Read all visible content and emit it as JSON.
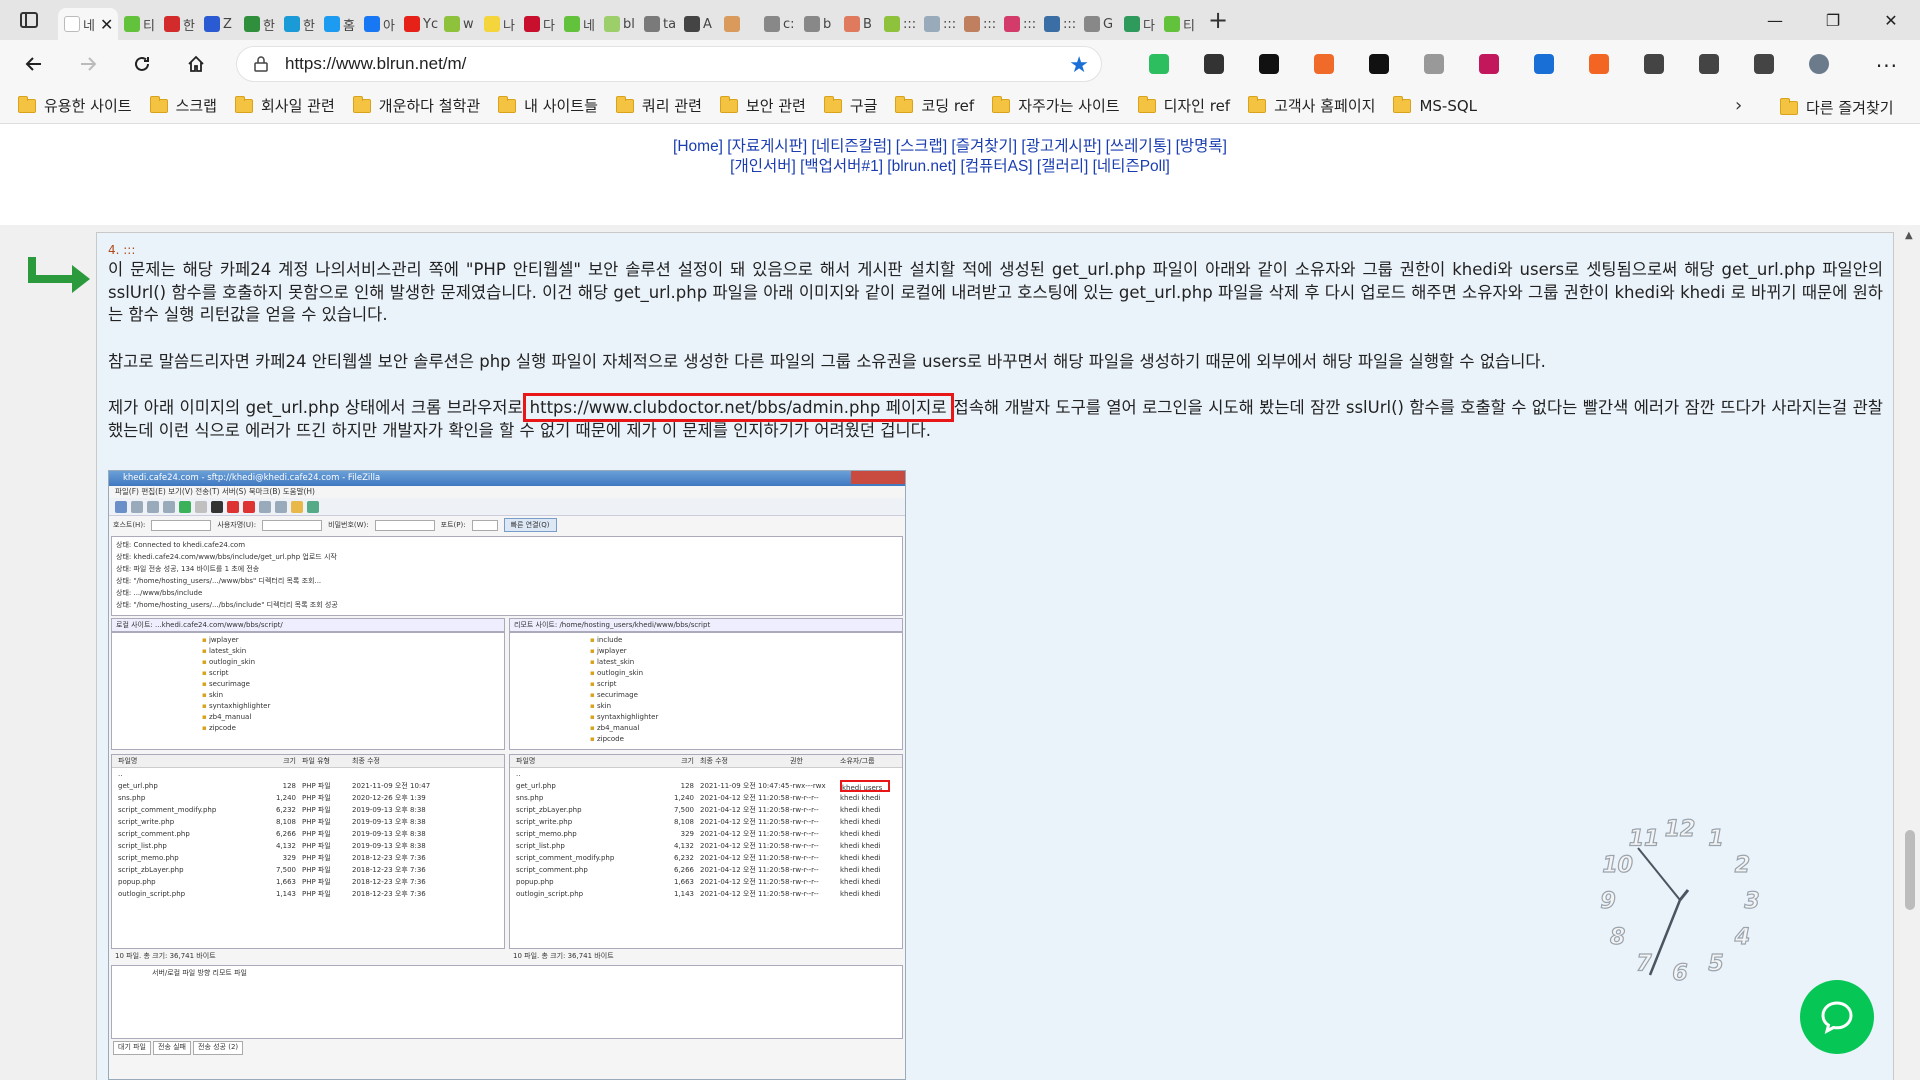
{
  "browser": {
    "tabs": [
      {
        "label": "네",
        "color": "#ffffff",
        "active": true
      },
      {
        "label": "티",
        "color": "#63c23c"
      },
      {
        "label": "한",
        "color": "#d32b2b"
      },
      {
        "label": "Z",
        "color": "#2b5bd3"
      },
      {
        "label": "한",
        "color": "#2f8f3c"
      },
      {
        "label": "한",
        "color": "#1a9ad6"
      },
      {
        "label": "홈",
        "color": "#1d9bf0"
      },
      {
        "label": "아",
        "color": "#1877f2"
      },
      {
        "label": "Yc",
        "color": "#e62117"
      },
      {
        "label": "w",
        "color": "#8fc23c"
      },
      {
        "label": "나",
        "color": "#f5d53c"
      },
      {
        "label": "다",
        "color": "#c8102e"
      },
      {
        "label": "네",
        "color": "#63c23c"
      },
      {
        "label": "bl",
        "color": "#9ccf6a"
      },
      {
        "label": "ta",
        "color": "#7a7a7a"
      },
      {
        "label": "A",
        "color": "#444444"
      },
      {
        "label": "",
        "color": "#d99a5c"
      },
      {
        "label": "c:",
        "color": "#888888"
      },
      {
        "label": "b",
        "color": "#888888"
      },
      {
        "label": "B",
        "color": "#e07a5f"
      },
      {
        "label": ":::",
        "color": "#8fc23c"
      },
      {
        "label": ":::",
        "color": "#9ab"
      },
      {
        "label": ":::",
        "color": "#c08060"
      },
      {
        "label": ":::",
        "color": "#d33b6a"
      },
      {
        "label": ":::",
        "color": "#3a6ea5"
      },
      {
        "label": "G",
        "color": "#888888"
      },
      {
        "label": "다",
        "color": "#2e9a5c"
      },
      {
        "label": "티",
        "color": "#63c23c"
      }
    ],
    "new_tab_label": "+",
    "window": {
      "minimize": "—",
      "restore": "❐",
      "close": "✕"
    },
    "url": "https://www.blrun.net/m/",
    "extensions": [
      {
        "name": "evernote-icon",
        "color": "#2dbe60"
      },
      {
        "name": "e-circle-icon",
        "color": "#333333"
      },
      {
        "name": "binary-icon",
        "color": "#111111"
      },
      {
        "name": "ex-icon",
        "color": "#f06a2a"
      },
      {
        "name": "download-arrow-icon",
        "color": "#111111"
      },
      {
        "name": "camera-icon",
        "color": "#999999"
      },
      {
        "name": "color-wheel-icon",
        "color": "#c2185b"
      },
      {
        "name": "layers-icon",
        "color": "#1a6fd6"
      },
      {
        "name": "rss-icon",
        "color": "#f26522"
      },
      {
        "name": "puzzle-icon",
        "color": "#444444"
      },
      {
        "name": "favorites-icon",
        "color": "#444444"
      },
      {
        "name": "collections-icon",
        "color": "#444444"
      },
      {
        "name": "profile-avatar-icon",
        "color": "#6b7b8c"
      }
    ]
  },
  "bookmarks": {
    "items": [
      "유용한 사이트",
      "스크랩",
      "회사일 관련",
      "개운하다 철학관",
      "내 사이트들",
      "쿼리 관련",
      "보안 관련",
      "구글",
      "코딩 ref",
      "자주가는 사이트",
      "디자인 ref",
      "고객사 홈페이지",
      "MS-SQL"
    ],
    "more": "›",
    "other": "다른 즐겨찾기"
  },
  "topnav": {
    "line1": "[Home] [자료게시판] [네티즌칼럼] [스크랩] [즐겨찾기] [광고게시판] [쓰레기통] [방명록]",
    "line2": "[개인서버] [백업서버#1] [blrun.net] [컴퓨터AS] [갤러리] [네티즌Poll]"
  },
  "post": {
    "number": "4. :::",
    "para1": "이 문제는 해당 카페24 계정 나의서비스관리 쪽에 \"PHP 안티웹셀\" 보안 솔루션 설정이 돼 있음으로 해서 게시판 설치할 적에 생성된 get_url.php 파일이 아래와 같이 소유자와 그룹 권한이 khedi와 users로 셋팅됨으로써 해당 get_url.php 파일안의 sslUrl() 함수를 호출하지 못함으로 인해 발생한 문제였습니다. 이건 해당 get_url.php 파일을 아래 이미지와 같이 로컬에 내려받고 호스팅에 있는 get_url.php 파일을 삭제 후 다시 업로드 해주면 소유자와 그룹 권한이 khedi와 khedi 로 바뀌기 때문에 원하는 함수 실행 리턴값을 얻을 수 있습니다.",
    "para2": "참고로 말씀드리자면 카페24 안티웹셀 보안 솔루션은 php 실행 파일이 자체적으로 생성한 다른 파일의 그룹 소유권을 users로 바꾸면서 해당 파일을 생성하기 때문에 외부에서 해당 파일을 실행할 수 없습니다.",
    "para3_before": "제가 아래 이미지의 get_url.php 상태에서 크롬 브라우저로",
    "para3_highlight": "https://www.clubdoctor.net/bbs/admin.php 페이지로",
    "para3_after": "접속해 개발자 도구를 열어 로그인을 시도해 봤는데 잠깐 sslUrl() 함수를 호출할 수 없다는 빨간색 에러가 잠깐 뜨다가 사라지는걸 관찰했는데 이런 식으로 에러가 뜨긴 하지만 개발자가 확인을 할 수 없기 때문에 제가 이 문제를 인지하기가 어려웠던 겁니다."
  },
  "filezilla": {
    "title": "khedi.cafe24.com - sftp://khedi@khedi.cafe24.com - FileZilla",
    "menu": "파일(F)  편집(E)  보기(V)  전송(T)  서버(S)  북마크(B)  도움말(H)",
    "quick": {
      "host": "호스트(H):",
      "user": "사용자명(U):",
      "pass": "비밀번호(W):",
      "port": "포트(P):",
      "connect": "빠른 연결(Q)"
    },
    "log": [
      "상태:   Connected to khedi.cafe24.com",
      "상태:   khedi.cafe24.com/www/bbs/include/get_url.php 업로드 시작",
      "상태:   파일 전송 성공, 134 바이트를 1 초에 전송",
      "상태:   \"/home/hosting_users/.../www/bbs\" 디렉터리 목록 조회...",
      "상태:   .../www/bbs/include",
      "상태:   \"/home/hosting_users/.../bbs/include\" 디렉터리 목록 조회 성공"
    ],
    "local_label": "로컬 사이트:  ...khedi.cafe24.com/www/bbs/script/",
    "remote_label": "리모트 사이트:  /home/hosting_users/khedi/www/bbs/script",
    "local_tree": [
      "jwplayer",
      "latest_skin",
      "outlogin_skin",
      "script",
      "securimage",
      "skin",
      "syntaxhighlighter",
      "zb4_manual",
      "zipcode"
    ],
    "remote_tree": [
      "include",
      "jwplayer",
      "latest_skin",
      "outlogin_skin",
      "script",
      "securimage",
      "skin",
      "syntaxhighlighter",
      "zb4_manual",
      "zipcode"
    ],
    "local_headers": [
      "파일명",
      "크기",
      "파일 유형",
      "최종 수정"
    ],
    "remote_headers": [
      "파일명",
      "크기",
      "최종 수정",
      "권한",
      "소유자/그룹"
    ],
    "local_rows": [
      [
        "..",
        "",
        "",
        ""
      ],
      [
        "get_url.php",
        "128",
        "PHP 파일",
        "2021-11-09 오전 10:47"
      ],
      [
        "sns.php",
        "1,240",
        "PHP 파일",
        "2020-12-26 오후 1:39"
      ],
      [
        "script_comment_modify.php",
        "6,232",
        "PHP 파일",
        "2019-09-13 오후 8:38"
      ],
      [
        "script_write.php",
        "8,108",
        "PHP 파일",
        "2019-09-13 오후 8:38"
      ],
      [
        "script_comment.php",
        "6,266",
        "PHP 파일",
        "2019-09-13 오후 8:38"
      ],
      [
        "script_list.php",
        "4,132",
        "PHP 파일",
        "2019-09-13 오후 8:38"
      ],
      [
        "script_memo.php",
        "329",
        "PHP 파일",
        "2018-12-23 오후 7:36"
      ],
      [
        "script_zbLayer.php",
        "7,500",
        "PHP 파일",
        "2018-12-23 오후 7:36"
      ],
      [
        "popup.php",
        "1,663",
        "PHP 파일",
        "2018-12-23 오후 7:36"
      ],
      [
        "outlogin_script.php",
        "1,143",
        "PHP 파일",
        "2018-12-23 오후 7:36"
      ]
    ],
    "remote_rows": [
      [
        "..",
        "",
        "",
        "",
        ""
      ],
      [
        "get_url.php",
        "128",
        "2021-11-09 오전 10:47:45",
        "-rwx---rwx",
        "khedi users"
      ],
      [
        "sns.php",
        "1,240",
        "2021-04-12 오전 11:20:58",
        "-rw-r--r--",
        "khedi khedi"
      ],
      [
        "script_zbLayer.php",
        "7,500",
        "2021-04-12 오전 11:20:58",
        "-rw-r--r--",
        "khedi khedi"
      ],
      [
        "script_write.php",
        "8,108",
        "2021-04-12 오전 11:20:58",
        "-rw-r--r--",
        "khedi khedi"
      ],
      [
        "script_memo.php",
        "329",
        "2021-04-12 오전 11:20:58",
        "-rw-r--r--",
        "khedi khedi"
      ],
      [
        "script_list.php",
        "4,132",
        "2021-04-12 오전 11:20:58",
        "-rw-r--r--",
        "khedi khedi"
      ],
      [
        "script_comment_modify.php",
        "6,232",
        "2021-04-12 오전 11:20:58",
        "-rw-r--r--",
        "khedi khedi"
      ],
      [
        "script_comment.php",
        "6,266",
        "2021-04-12 오전 11:20:58",
        "-rw-r--r--",
        "khedi khedi"
      ],
      [
        "popup.php",
        "1,663",
        "2021-04-12 오전 11:20:58",
        "-rw-r--r--",
        "khedi khedi"
      ],
      [
        "outlogin_script.php",
        "1,143",
        "2021-04-12 오전 11:20:58",
        "-rw-r--r--",
        "khedi khedi"
      ]
    ],
    "local_status": "10 파일. 총 크기: 36,741 바이트",
    "remote_status": "10 파일. 총 크기: 36,741 바이트",
    "queue_headers": "서버/로컬 파일                                    방향          리모트 파일",
    "queue_tabs": [
      "대기 파일",
      "전송 실패",
      "전송 성공 (2)"
    ]
  },
  "clock": {
    "numbers": [
      "12",
      "1",
      "2",
      "3",
      "4",
      "5",
      "6",
      "7",
      "8",
      "9",
      "10",
      "11"
    ]
  },
  "colors": {
    "link": "#1a3db0",
    "highlight_border": "#e81616",
    "arrow": "#2a9a3c",
    "chat": "#06c755"
  }
}
